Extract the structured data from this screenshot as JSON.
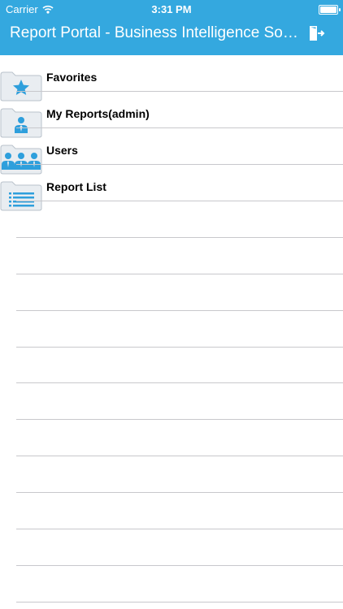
{
  "status_bar": {
    "carrier": "Carrier",
    "time": "3:31 PM"
  },
  "nav": {
    "title": "Report Portal - Business Intelligence Solutions",
    "logout_icon": "logout-door-icon"
  },
  "menu": [
    {
      "label": "Favorites",
      "icon": "star-icon"
    },
    {
      "label": "My Reports(admin)",
      "icon": "person-icon"
    },
    {
      "label": "Users",
      "icon": "users-icon"
    },
    {
      "label": "Report List",
      "icon": "list-icon"
    }
  ],
  "colors": {
    "accent": "#34a8df",
    "folder_fill": "#e9edf1",
    "folder_stroke": "#b9c2cb",
    "icon_blue": "#2e9fdc"
  }
}
